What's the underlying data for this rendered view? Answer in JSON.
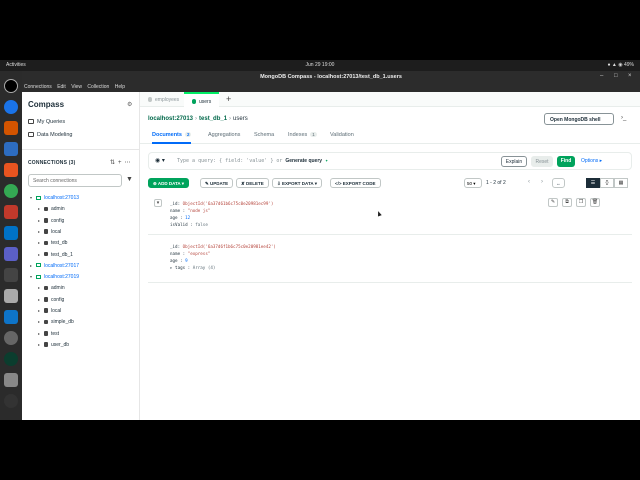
{
  "os": {
    "activities": "Activities",
    "clock": "Jun 29  19:00",
    "tray": "● ▲ ◉ 49%"
  },
  "window": {
    "title": "MongoDB Compass - localhost:27013/test_db_1.users",
    "menu": [
      "Connections",
      "Edit",
      "View",
      "Collection",
      "Help"
    ]
  },
  "sidebar": {
    "title": "Compass",
    "links": [
      "My Queries",
      "Data Modeling"
    ],
    "connections_label": "CONNECTIONS (3)",
    "search_placeholder": "Search connections",
    "tree": [
      {
        "label": "localhost:27013",
        "level": 0,
        "kind": "conn",
        "open": true
      },
      {
        "label": "admin",
        "level": 1,
        "kind": "db"
      },
      {
        "label": "config",
        "level": 1,
        "kind": "db"
      },
      {
        "label": "local",
        "level": 1,
        "kind": "db"
      },
      {
        "label": "test_db",
        "level": 1,
        "kind": "db"
      },
      {
        "label": "test_db_1",
        "level": 1,
        "kind": "db"
      },
      {
        "label": "localhost:27017",
        "level": 0,
        "kind": "conn",
        "open": false
      },
      {
        "label": "localhost:27019",
        "level": 0,
        "kind": "conn",
        "open": true
      },
      {
        "label": "admin",
        "level": 1,
        "kind": "db"
      },
      {
        "label": "config",
        "level": 1,
        "kind": "db"
      },
      {
        "label": "local",
        "level": 1,
        "kind": "db"
      },
      {
        "label": "simple_db",
        "level": 1,
        "kind": "db"
      },
      {
        "label": "test",
        "level": 1,
        "kind": "db"
      },
      {
        "label": "user_db",
        "level": 1,
        "kind": "db"
      }
    ]
  },
  "main": {
    "tabs": [
      {
        "label": "employees",
        "active": false
      },
      {
        "label": "users",
        "active": true
      }
    ],
    "breadcrumb": {
      "host": "localhost:27013",
      "db": "test_db_1",
      "coll": "users"
    },
    "shell_button": "Open MongoDB shell",
    "subtabs": [
      {
        "label": "Documents",
        "count": "2",
        "active": true
      },
      {
        "label": "Aggregations",
        "count": "",
        "active": false
      },
      {
        "label": "Schema",
        "count": "",
        "active": false
      },
      {
        "label": "Indexes",
        "count": "1",
        "active": false
      },
      {
        "label": "Validation",
        "count": "",
        "active": false
      }
    ],
    "query": {
      "placeholder": "Type a query: { field: 'value' } or",
      "generate": "Generate query",
      "explain": "Explain",
      "reset": "Reset",
      "find": "Find",
      "options": "Options ▸"
    },
    "toolbar": {
      "add_data": "⊕ ADD DATA ▾",
      "update": "✎ UPDATE",
      "delete": "✘ DELETE",
      "export_data": "⇩ EXPORT DATA ▾",
      "export_code": "</> EXPORT CODE",
      "page_size": "50 ▾",
      "page_info": "1 - 2 of 2"
    },
    "documents": [
      {
        "id": "ObjectId('6a37d61b6c75c0e20981ec99')",
        "fields": [
          {
            "key": "name",
            "value": "\"node js\"",
            "type": "s"
          },
          {
            "key": "age",
            "value": "12",
            "type": "n"
          },
          {
            "key": "isValid",
            "value": "false",
            "type": "g"
          }
        ]
      },
      {
        "id": "ObjectId('6a37d6f1b6c75c0e20981ee42')",
        "fields": [
          {
            "key": "name",
            "value": "\"express\"",
            "type": "s"
          },
          {
            "key": "age",
            "value": "9",
            "type": "n"
          },
          {
            "key": "▸ tags",
            "value": "Array (4)",
            "type": "g"
          }
        ]
      }
    ]
  }
}
